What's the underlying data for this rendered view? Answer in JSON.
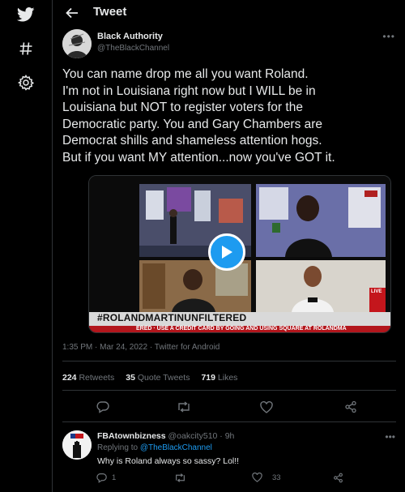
{
  "sidebar": {
    "icons": [
      "twitter-logo-icon",
      "hashtag-icon",
      "settings-icon"
    ]
  },
  "header": {
    "title": "Tweet"
  },
  "tweet": {
    "author_name": "Black Authority",
    "author_handle": "@TheBlackChannel",
    "text": "You can name drop me all you want Roland.\nI'm not in Louisiana right now but I WILL be in\nLouisiana but NOT to register voters for the\nDemocratic party. You and Gary Chambers are\nDemocrat shills and shameless attention hogs.\nBut if you want MY attention...now you've GOT it.",
    "meta": "1:35 PM · Mar 24, 2022 · Twitter for Android",
    "stats": {
      "retweets_count": "224",
      "retweets_label": "Retweets",
      "quotes_count": "35",
      "quotes_label": "Quote Tweets",
      "likes_count": "719",
      "likes_label": "Likes"
    },
    "media": {
      "banner_text": "#ROLANDMARTINUNFILTERED",
      "ticker_text": "ERED · USE A CREDIT CARD BY GOING AND USING SQUARE AT ROLANDMA",
      "live_label": "LIVE"
    }
  },
  "reply": {
    "author_name": "FBAtownbizness",
    "author_handle": "@oakcity510",
    "time": "9h",
    "replying_prefix": "Replying to",
    "replying_to": "@TheBlackChannel",
    "text": "Why is Roland always so sassy? Lol!!",
    "reply_count": "1",
    "like_count": "33"
  },
  "colors": {
    "background": "#000000",
    "accent": "#1d9bf0",
    "text": "#e7e9ea",
    "muted": "#71767b",
    "border": "#2f3336"
  }
}
